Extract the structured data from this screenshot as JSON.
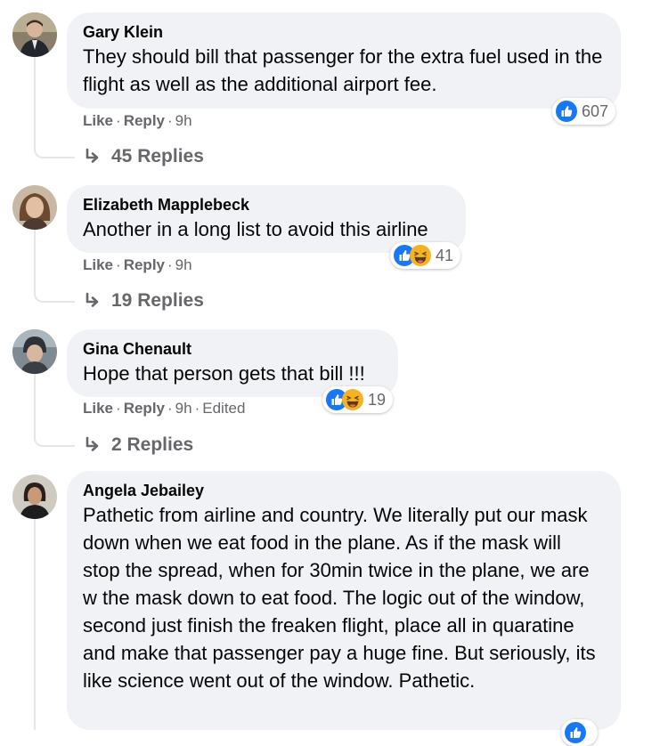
{
  "comments": [
    {
      "author": "Gary Klein",
      "text": "They should bill that passenger for the extra fuel used in the flight as well as the additional airport fee.",
      "like_label": "Like",
      "reply_label": "Reply",
      "time": "9h",
      "reaction_count": "607",
      "reaction_types": [
        "like-icon"
      ],
      "replies_label": "45 Replies"
    },
    {
      "author": "Elizabeth Mapplebeck",
      "text": "Another in a long list to avoid this airline",
      "like_label": "Like",
      "reply_label": "Reply",
      "time": "9h",
      "reaction_count": "41",
      "reaction_types": [
        "like-icon",
        "haha-icon"
      ],
      "replies_label": "19 Replies"
    },
    {
      "author": "Gina Chenault",
      "text": "Hope that person gets that bill !!!",
      "like_label": "Like",
      "reply_label": "Reply",
      "time": "9h",
      "edited_label": "Edited",
      "reaction_count": "19",
      "reaction_types": [
        "like-icon",
        "haha-icon"
      ],
      "replies_label": "2 Replies"
    },
    {
      "author": "Angela Jebailey",
      "text": "Pathetic from airline and country. We literally put our mask down when we eat food in the plane. As if the mask will stop the spread, when for 30min twice in the plane, we are w the mask down to eat food. The logic out of the window, second just finish the freaken flight, place all in quaratine and make that passenger pay a huge fine. But seriously, its like science went out of the window. Pathetic.",
      "reaction_types": [
        "like-icon"
      ]
    }
  ],
  "separator": "·",
  "colors": {
    "bubble": "#f0f2f5",
    "secondary_text": "#65676b",
    "like_blue": "#1877f2",
    "haha_yellow": "#f7b125"
  }
}
